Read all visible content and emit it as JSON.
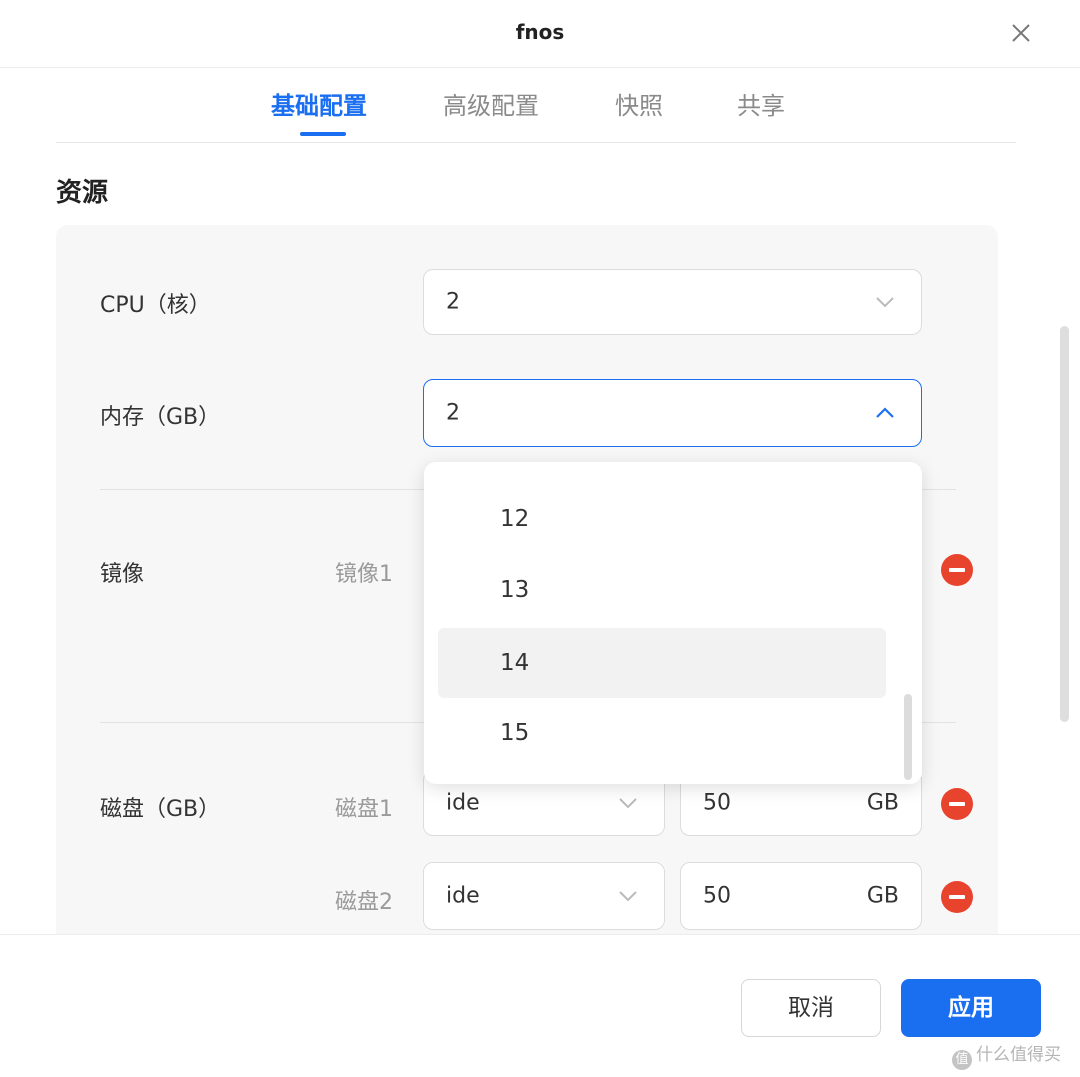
{
  "window": {
    "title": "fnos"
  },
  "tabs": [
    {
      "label": "基础配置",
      "active": true
    },
    {
      "label": "高级配置",
      "active": false
    },
    {
      "label": "快照",
      "active": false
    },
    {
      "label": "共享",
      "active": false
    }
  ],
  "section": {
    "title": "资源"
  },
  "cpu": {
    "label": "CPU（核）",
    "value": "2"
  },
  "memory": {
    "label": "内存（GB）",
    "value": "2",
    "expanded": true
  },
  "memory_options": [
    {
      "label": "12"
    },
    {
      "label": "13"
    },
    {
      "label": "14",
      "hovered": true
    },
    {
      "label": "15"
    }
  ],
  "image": {
    "label": "镜像",
    "item_label": "镜像1"
  },
  "disks": {
    "label": "磁盘（GB）",
    "items": [
      {
        "label": "磁盘1",
        "type": "ide",
        "size": "50",
        "unit": "GB"
      },
      {
        "label": "磁盘2",
        "type": "ide",
        "size": "50",
        "unit": "GB"
      }
    ]
  },
  "footer": {
    "cancel_label": "取消",
    "apply_label": "应用"
  },
  "watermark": {
    "icon_text": "值",
    "text": "什么值得买"
  },
  "colors": {
    "accent": "#1a6ef0",
    "danger": "#e8432d",
    "panel_bg": "#f7f7f7"
  },
  "icons": [
    "close-icon",
    "chevron-down-icon",
    "chevron-up-icon",
    "remove-icon"
  ]
}
